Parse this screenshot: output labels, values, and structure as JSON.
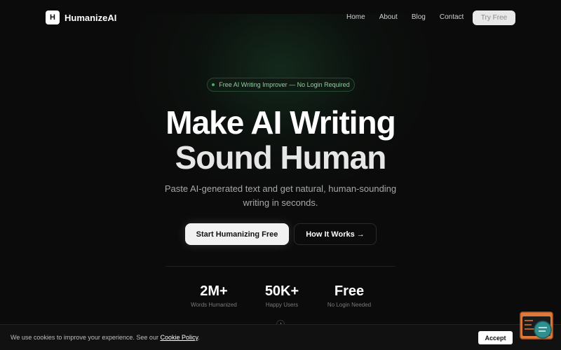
{
  "app": {
    "logo_letter": "H",
    "name": "HumanizeAI"
  },
  "nav": {
    "links": [
      "Home",
      "About",
      "Blog",
      "Contact"
    ],
    "cta": "Try Free"
  },
  "hero": {
    "badge": "Free AI Writing Improver — No Login Required",
    "headline_line1": "Make AI Writing",
    "headline_line2": "Sound Human",
    "subtitle": "Paste AI-generated text and get natural, human-sounding writing in seconds.",
    "primary_button": "Start Humanizing Free",
    "secondary_button": "How It Works →"
  },
  "stats": [
    {
      "value": "2M+",
      "label": "Words Humanized"
    },
    {
      "value": "50K+",
      "label": "Happy Users"
    },
    {
      "value": "Free",
      "label": "No Login Needed"
    }
  ],
  "cookie": {
    "text": "We use cookies to improve your experience. See our",
    "link": "Cookie Policy",
    "suffix": ".",
    "accept": "Accept"
  },
  "icons": {
    "badge_dot": "status-dot-icon",
    "scroll": "scroll-mouse-icon",
    "chat": "chat-widget-icon"
  },
  "colors": {
    "background": "#0b0b0b",
    "accent_green": "#3fb36a",
    "primary_button": "#f2f2f2",
    "widget_orange": "#e07a3a",
    "widget_teal": "#2f8f8f"
  }
}
